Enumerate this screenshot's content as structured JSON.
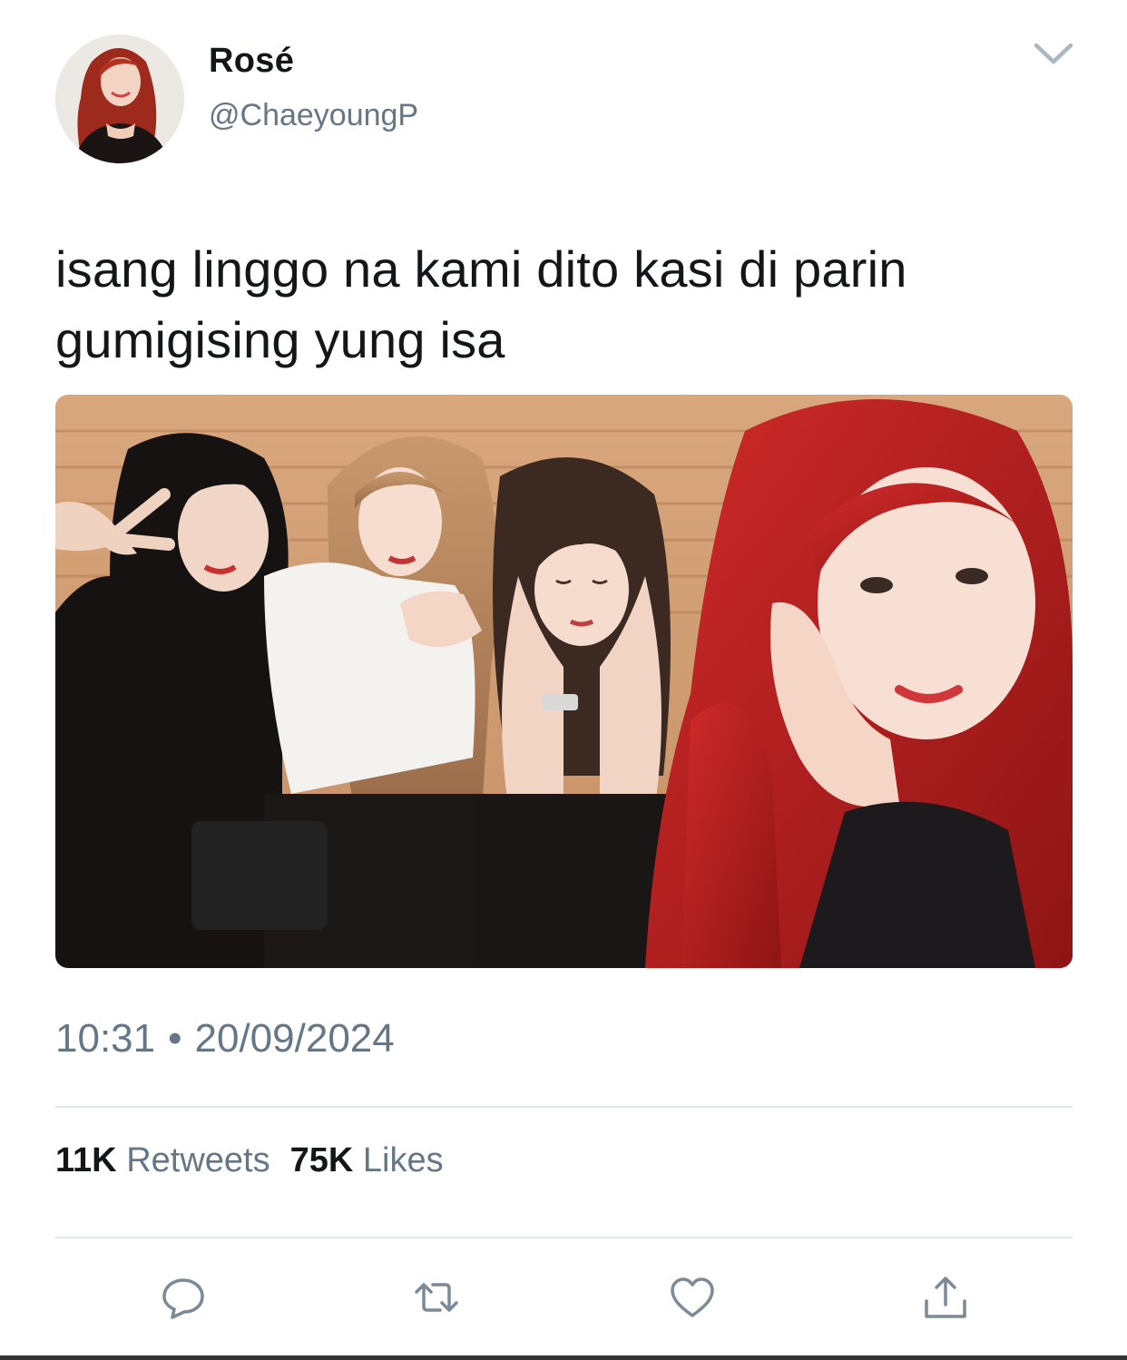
{
  "tweet": {
    "author": {
      "display_name": "Rosé",
      "handle": "@ChaeyoungP"
    },
    "text_lines": [
      "isang linggo na kami dito kasi di parin",
      "gumigising yung isa"
    ],
    "time": "10:31",
    "separator": "•",
    "date": "20/09/2024",
    "stats": {
      "retweets_count": "11K",
      "retweets_label": "Retweets",
      "likes_count": "75K",
      "likes_label": "Likes"
    }
  },
  "icons": {
    "menu": "chevron-down-icon",
    "actions": [
      "reply-icon",
      "retweet-icon",
      "like-icon",
      "share-icon"
    ]
  },
  "colors": {
    "text": "#14171a",
    "secondary": "#657786",
    "divider": "#e1e8ed"
  }
}
